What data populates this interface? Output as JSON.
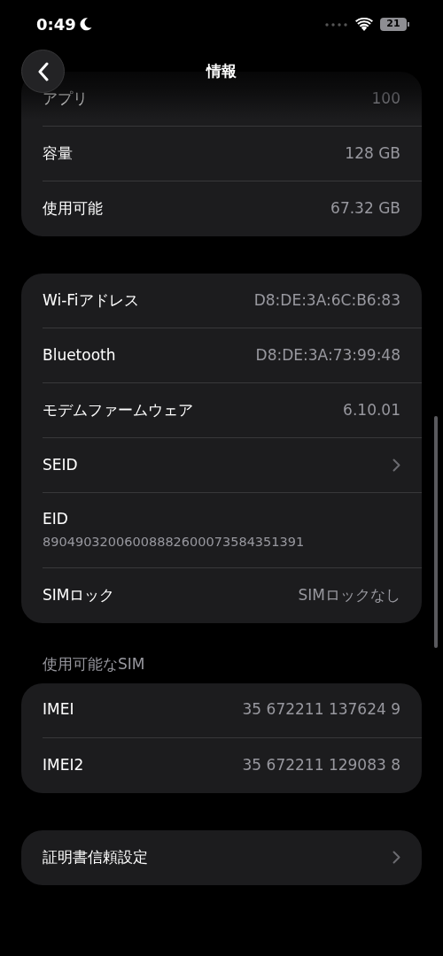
{
  "status_bar": {
    "time": "0:49",
    "battery": "21"
  },
  "header": {
    "title": "情報"
  },
  "groups": [
    {
      "rows": [
        {
          "kind": "value",
          "label": "アプリ",
          "value": "100"
        },
        {
          "kind": "value",
          "label": "容量",
          "value": "128 GB"
        },
        {
          "kind": "value",
          "label": "使用可能",
          "value": "67.32 GB"
        }
      ]
    },
    {
      "rows": [
        {
          "kind": "value",
          "label": "Wi-Fiアドレス",
          "value": "D8:DE:3A:6C:B6:83"
        },
        {
          "kind": "value",
          "label": "Bluetooth",
          "value": "D8:DE:3A:73:99:48"
        },
        {
          "kind": "value",
          "label": "モデムファームウェア",
          "value": "6.10.01"
        },
        {
          "kind": "link",
          "label": "SEID"
        },
        {
          "kind": "stacked",
          "label": "EID",
          "value": "89049032006008882600073584351391"
        },
        {
          "kind": "value",
          "label": "SIMロック",
          "value": "SIMロックなし"
        }
      ]
    },
    {
      "heading": "使用可能なSIM",
      "rows": [
        {
          "kind": "value",
          "label": "IMEI",
          "value": "35 672211 137624 9"
        },
        {
          "kind": "value",
          "label": "IMEI2",
          "value": "35 672211 129083 8"
        }
      ]
    },
    {
      "rows": [
        {
          "kind": "link",
          "label": "証明書信頼設定"
        }
      ]
    }
  ]
}
